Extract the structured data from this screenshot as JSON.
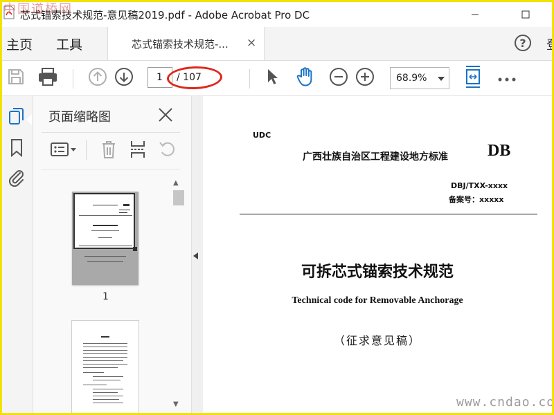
{
  "window": {
    "title": "芯式锚索技术规范-意见稿2019.pdf - Adobe Acrobat Pro DC",
    "watermark_top": "中国道桥网"
  },
  "tabs": {
    "home": "主页",
    "tools": "工具",
    "document": "芯式锚索技术规范-...",
    "document_close": "×",
    "help": "?",
    "signin": "登"
  },
  "toolbar": {
    "page_current": "1",
    "page_total": "/ 107",
    "zoom": "68.9%",
    "icons": [
      "save-icon",
      "print-icon",
      "prev-page-icon",
      "next-page-icon",
      "select-cursor-icon",
      "hand-tool-icon",
      "zoom-out-icon",
      "zoom-in-icon",
      "fit-page-icon",
      "more-icon"
    ],
    "highlight_color": "#e1251b"
  },
  "rail": {
    "icons": [
      "page-thumbnails-icon",
      "bookmark-icon",
      "attachment-icon"
    ],
    "active_color": "#1a73c8"
  },
  "panel": {
    "title": "页面缩略图",
    "close": "×",
    "thumbnails": [
      {
        "label": "1"
      }
    ],
    "tools": [
      "options-menu-icon",
      "delete-icon",
      "insert-pages-icon",
      "rotate-icon"
    ]
  },
  "document": {
    "udc": "UDC",
    "org": "广西壮族自治区工程建设地方标准",
    "db": "DB",
    "code": "DBJ/TXX-xxxx",
    "record": "备案号：xxxxx",
    "title_cn": "可拆芯式锚索技术规范",
    "title_en": "Technical code for Removable Anchorage",
    "draft": "（征求意见稿）"
  },
  "watermark_bottom": "www.cndao.com"
}
